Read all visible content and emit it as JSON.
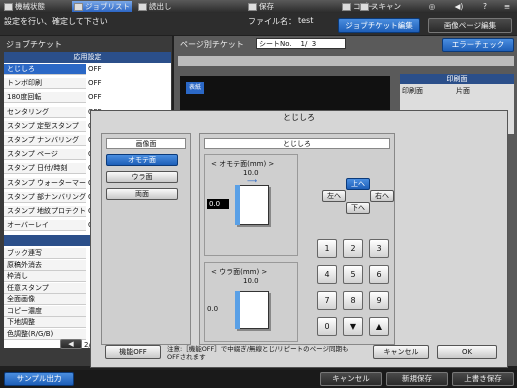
{
  "topbar": {
    "tabs": [
      "機械状態",
      "ジョブリスト",
      "読出し",
      "保存",
      "コピー",
      "スキャン"
    ]
  },
  "subbar": {
    "message": "設定を行い、確定して下さい",
    "filename_label": "ファイル名：",
    "filename": "test",
    "tab_ticket_edit": "ジョブチケット編集",
    "tab_image_edit": "画像ページ編集"
  },
  "left": {
    "title": "ジョブチケット",
    "section_apply": "応用設定",
    "items": [
      {
        "label": "とじしろ",
        "value": "OFF"
      },
      {
        "label": "トンボ印刷",
        "value": "OFF"
      },
      {
        "label": "180度回転",
        "value": "OFF"
      },
      {
        "label": "センタリング",
        "value": "OFF"
      },
      {
        "label": "スタンプ 定型スタンプ",
        "value": "OFF"
      },
      {
        "label": "スタンプ ナンバリング",
        "value": "OFF"
      },
      {
        "label": "スタンプ ページ",
        "value": "OFF"
      },
      {
        "label": "スタンプ 日付/時刻",
        "value": "OFF"
      },
      {
        "label": "スタンプ ウォーターマーク",
        "value": "OFF"
      },
      {
        "label": "スタンプ 部ナンバリング",
        "value": "OFF"
      },
      {
        "label": "スタンプ 地紋プロテクト",
        "value": "OFF"
      },
      {
        "label": "オーバーレイ",
        "value": "OFF"
      }
    ],
    "section_other": "その他",
    "other_items": [
      "ブック連写",
      "原稿外消去",
      "枠消し",
      "任意スタンプ",
      "全面画像",
      "コピー濃度",
      "下地調整",
      "色調整(R/G/B)"
    ],
    "page_indicator": "2/"
  },
  "right": {
    "per_page_label": "ページ別チケット",
    "sheet_label": "シートNo.",
    "sheet_value": "1/",
    "sheet_total": "3",
    "error_check": "エラーチェック",
    "print_side_title": "印刷面",
    "print_side_label": "印刷面",
    "print_side_value": "片面",
    "thumb_label": "表紙"
  },
  "dialog": {
    "title": "とじしろ",
    "image_side_title": "画像面",
    "side_options": [
      "オモテ面",
      "ウラ面",
      "両面"
    ],
    "margin_title": "とじしろ",
    "front_label": "オモテ面(mm)",
    "front_value_top": "10.0",
    "front_value_left": "0.0",
    "back_label": "ウラ面(mm)",
    "back_value_top": "10.0",
    "back_value_left": "0.0",
    "dir_up": "上へ",
    "dir_left": "左へ",
    "dir_right": "右へ",
    "dir_down": "下へ",
    "keys": [
      "1",
      "2",
      "3",
      "4",
      "5",
      "6",
      "7",
      "8",
      "9",
      "0",
      "▼",
      "▲"
    ],
    "func_off": "機能OFF",
    "note": "注意:［機能OFF］で中綴ぎ/無線とじ/リピートのページ同期もOFFされます",
    "cancel": "キャンセル",
    "ok": "OK"
  },
  "bottom": {
    "sample_print": "サンプル出力",
    "cancel": "キャンセル",
    "save_new": "新規保存",
    "overwrite": "上書き保存"
  }
}
